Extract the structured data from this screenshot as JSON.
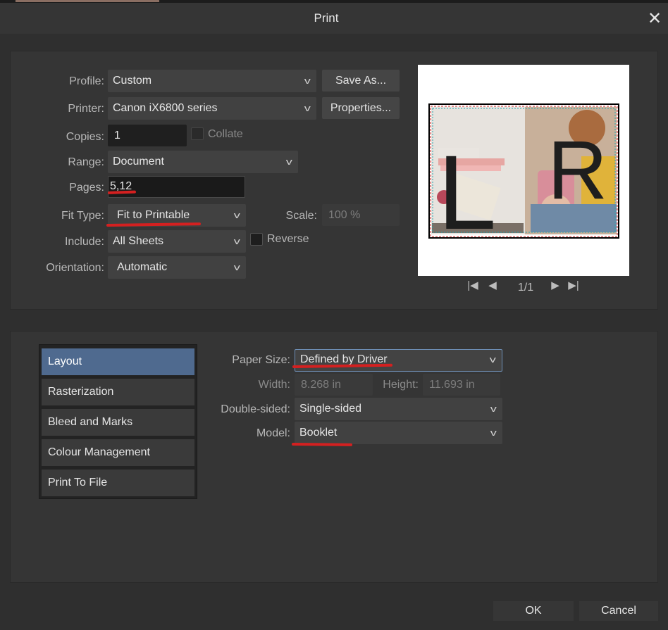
{
  "dialog": {
    "title": "Print",
    "close_icon": "close-icon"
  },
  "general": {
    "profile_label": "Profile:",
    "profile_value": "Custom",
    "save_as_label": "Save As...",
    "printer_label": "Printer:",
    "printer_value": "Canon iX6800 series",
    "properties_label": "Properties...",
    "copies_label": "Copies:",
    "copies_value": "1",
    "collate_label": "Collate",
    "range_label": "Range:",
    "range_value": "Document",
    "pages_label": "Pages:",
    "pages_value": "5,12",
    "fit_type_label": "Fit Type:",
    "fit_type_value": "Fit to Printable",
    "scale_label": "Scale:",
    "scale_value": "100 %",
    "include_label": "Include:",
    "include_value": "All Sheets",
    "reverse_label": "Reverse",
    "orientation_label": "Orientation:",
    "orientation_value": "Automatic"
  },
  "preview": {
    "page_counter": "1/1",
    "letter_left": "L",
    "letter_right": "R",
    "nav_icons": [
      "first-page-icon",
      "prev-page-icon",
      "next-page-icon",
      "last-page-icon"
    ]
  },
  "sidebar": {
    "items": [
      {
        "label": "Layout",
        "active": true
      },
      {
        "label": "Rasterization",
        "active": false
      },
      {
        "label": "Bleed and Marks",
        "active": false
      },
      {
        "label": "Colour Management",
        "active": false
      },
      {
        "label": "Print To File",
        "active": false
      }
    ]
  },
  "layout": {
    "paper_size_label": "Paper Size:",
    "paper_size_value": "Defined by Driver",
    "width_label": "Width:",
    "width_value": "8.268 in",
    "height_label": "Height:",
    "height_value": "11.693 in",
    "double_sided_label": "Double-sided:",
    "double_sided_value": "Single-sided",
    "model_label": "Model:",
    "model_value": "Booklet"
  },
  "footer": {
    "ok_label": "OK",
    "cancel_label": "Cancel"
  },
  "colors": {
    "accent": "#4f6a8f",
    "annotation_red": "#d42020"
  }
}
